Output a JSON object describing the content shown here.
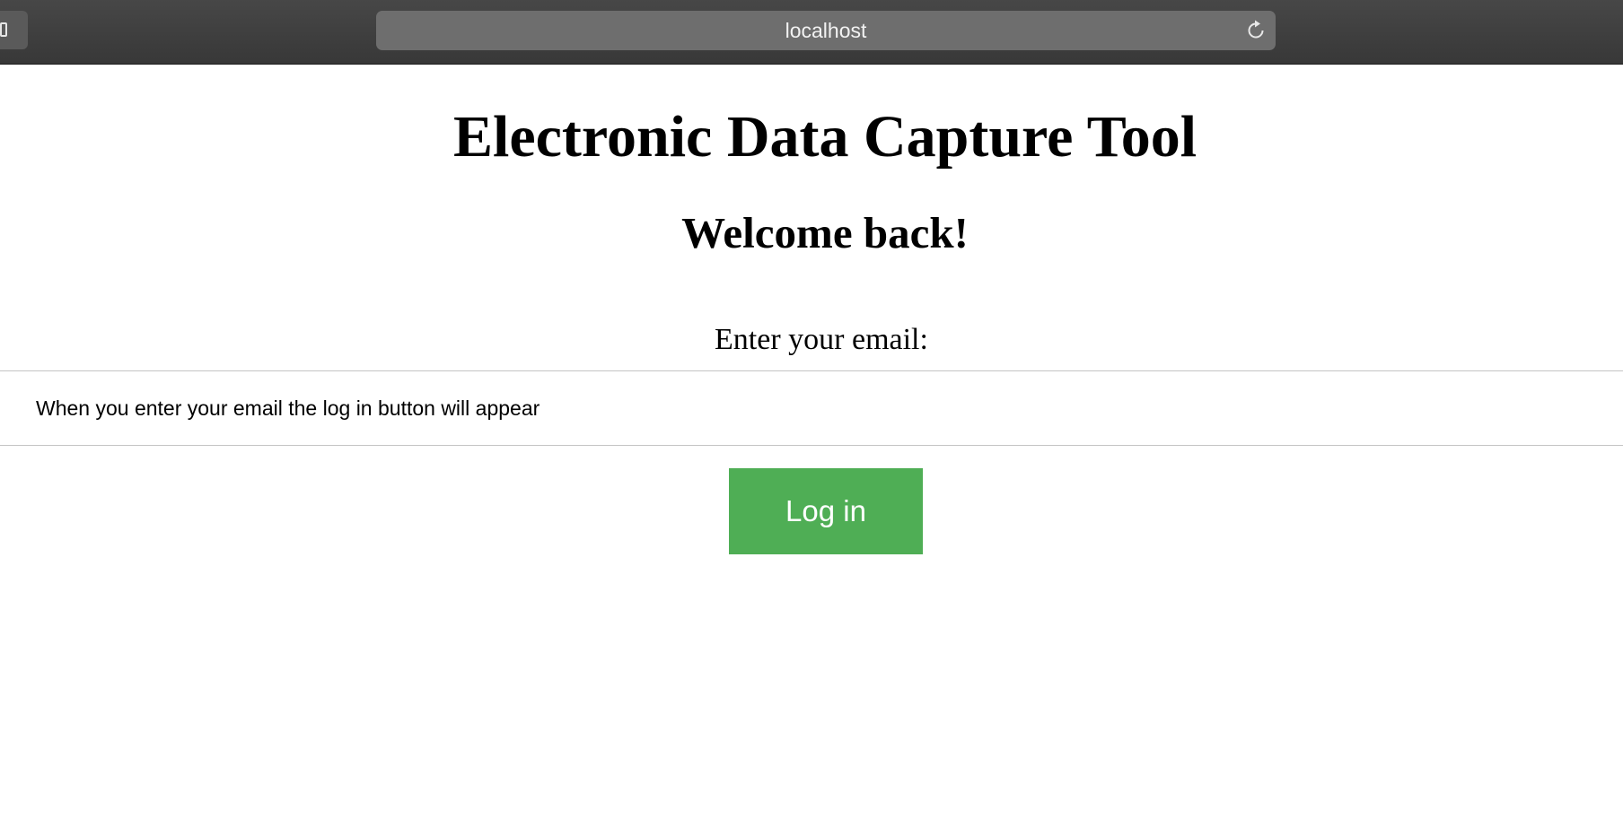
{
  "browser": {
    "address": "localhost"
  },
  "page": {
    "title": "Electronic Data Capture Tool",
    "welcome": "Welcome back!",
    "email_label": "Enter your email:",
    "email_placeholder": "When you enter your email the log in button will appear",
    "email_value": "",
    "login_label": "Log in"
  },
  "colors": {
    "login_button": "#4fae55",
    "browser_chrome": "#3a3a3a"
  },
  "icons": {
    "sidebar": "sidebar-icon",
    "reload": "reload-icon"
  }
}
